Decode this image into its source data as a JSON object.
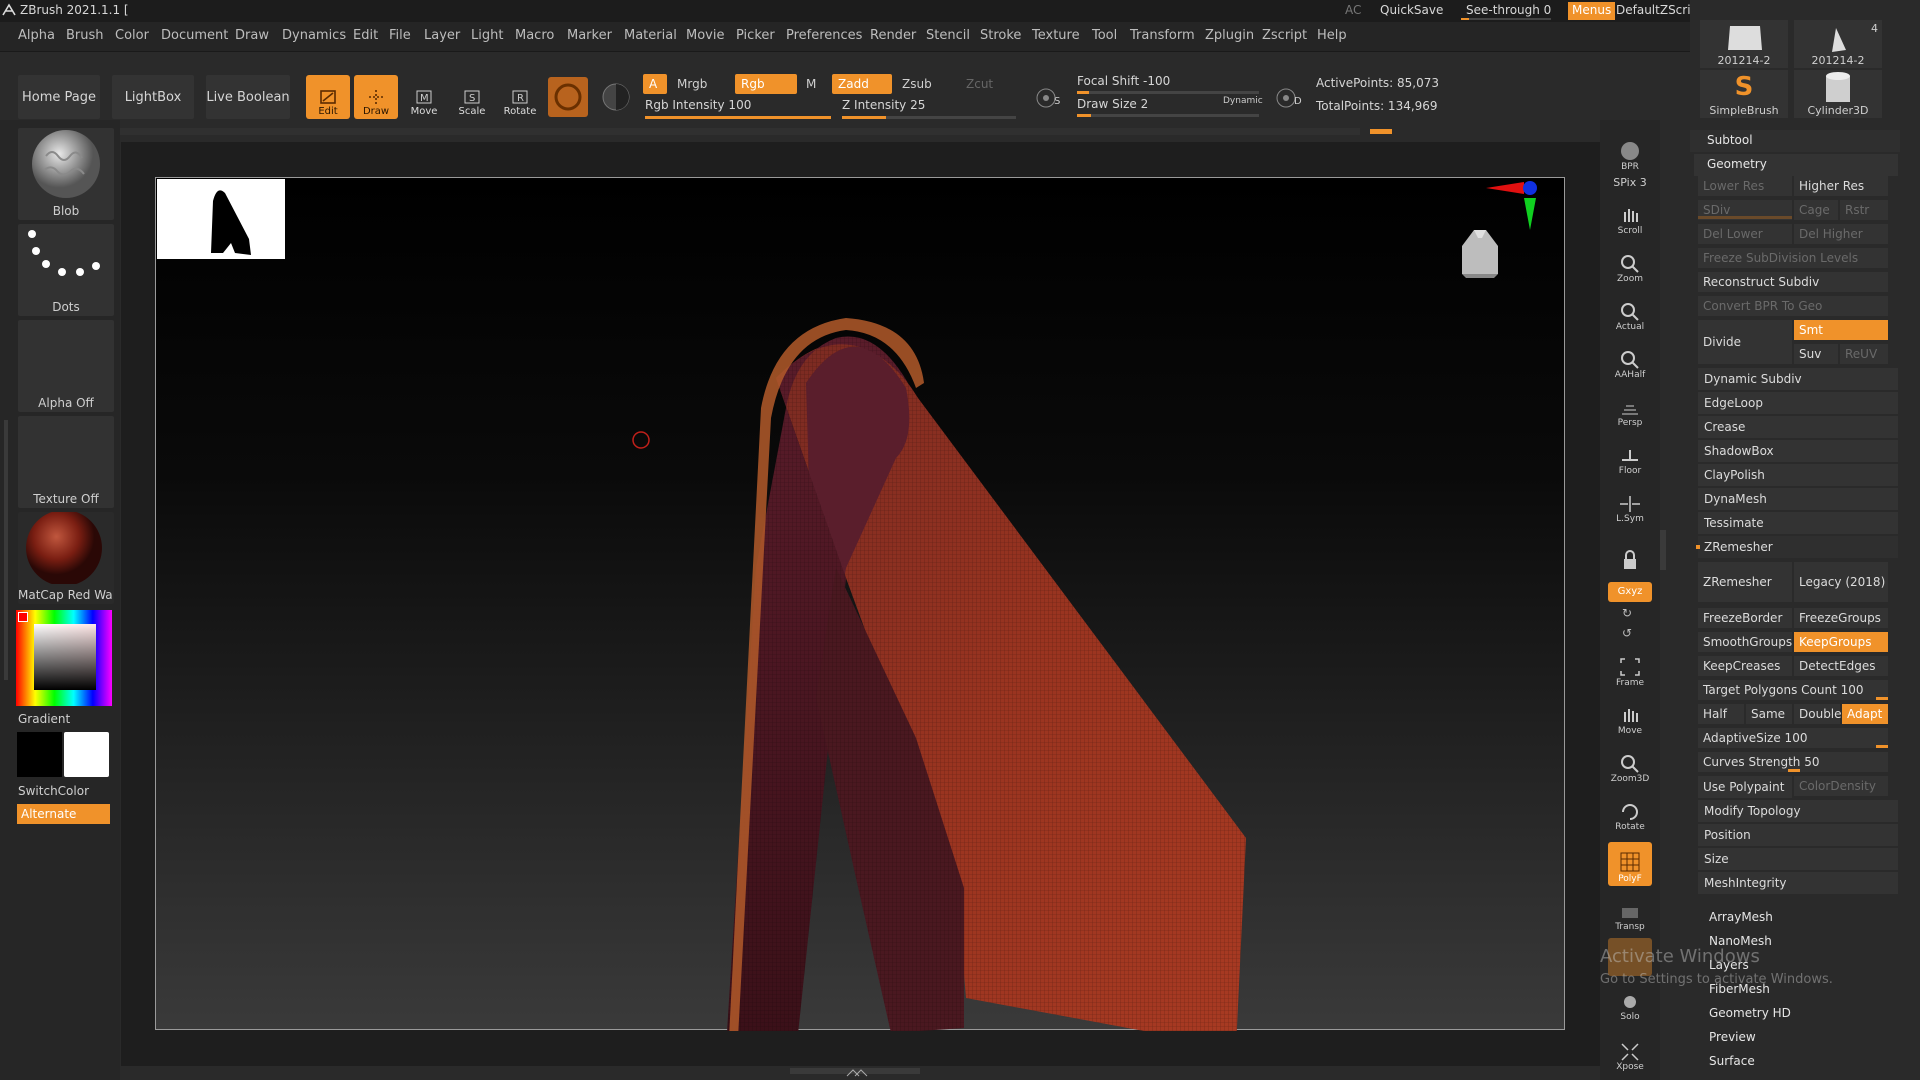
{
  "title": "ZBrush 2021.1.1 [",
  "titlebar": {
    "ac": "AC",
    "quicksave": "QuickSave",
    "seethrough": "See-through  0",
    "menus": "Menus",
    "script": "DefaultZScript"
  },
  "menu": [
    "Alpha",
    "Brush",
    "Color",
    "Document",
    "Draw",
    "Dynamics",
    "Edit",
    "File",
    "Layer",
    "Light",
    "Macro",
    "Marker",
    "Material",
    "Movie",
    "Picker",
    "Preferences",
    "Render",
    "Stencil",
    "Stroke",
    "Texture",
    "Tool",
    "Transform",
    "Zplugin",
    "Zscript",
    "Help"
  ],
  "toolbar": {
    "home_page": "Home Page",
    "lightbox": "LightBox",
    "live_boolean": "Live Boolean",
    "edit": "Edit",
    "draw": "Draw",
    "move": "Move",
    "scale": "Scale",
    "rotate": "Rotate",
    "a": "A",
    "mrgb": "Mrgb",
    "rgb": "Rgb",
    "m": "M",
    "zadd": "Zadd",
    "zsub": "Zsub",
    "zcut": "Zcut",
    "rgb_intensity": "Rgb Intensity 100",
    "rgb_intensity_value": 1.0,
    "z_intensity": "Z Intensity 25",
    "z_intensity_value": 0.25,
    "focal_shift": "Focal Shift -100",
    "draw_size": "Draw Size 2",
    "dynamic": "Dynamic",
    "s": "S",
    "d": "D",
    "active_points": "ActivePoints: 85,073",
    "total_points": "TotalPoints: 134,969"
  },
  "left_shelf": {
    "brush": "Blob",
    "stroke": "Dots",
    "alpha": "Alpha Off",
    "texture": "Texture Off",
    "material": "MatCap Red Wa:",
    "gradient": "Gradient",
    "switchcolor": "SwitchColor",
    "alternate": "Alternate"
  },
  "right_tools": [
    {
      "label": "BPR",
      "on": false
    },
    {
      "label": "SPix 3",
      "on": false
    },
    {
      "label": "Scroll",
      "on": false
    },
    {
      "label": "Zoom",
      "on": false
    },
    {
      "label": "Actual",
      "on": false
    },
    {
      "label": "AAHalf",
      "on": false
    },
    {
      "label": "Persp",
      "on": false
    },
    {
      "label": "Floor",
      "on": false
    },
    {
      "label": "L.Sym",
      "on": false
    },
    {
      "label": "Lock",
      "on": false
    },
    {
      "label": "Gxyz",
      "on": true
    },
    {
      "label": "Frame",
      "on": false
    },
    {
      "label": "Move",
      "on": false
    },
    {
      "label": "Zoom3D",
      "on": false
    },
    {
      "label": "Rotate",
      "on": false
    },
    {
      "label": "PolyF",
      "on": true
    },
    {
      "label": "Transp",
      "on": false
    },
    {
      "label": "Solo",
      "on": false
    },
    {
      "label": "Xpose",
      "on": false
    }
  ],
  "subtools": [
    {
      "label": "201214-2",
      "count": ""
    },
    {
      "label": "201214-2",
      "count": "4"
    },
    {
      "label": "SimpleBrush",
      "count": ""
    },
    {
      "label": "Cylinder3D",
      "count": ""
    }
  ],
  "panel": {
    "subtool": "Subtool",
    "geometry": "Geometry",
    "lower_res": "Lower Res",
    "higher_res": "Higher Res",
    "sdiv": "SDiv",
    "cage": "Cage",
    "rstr": "Rstr",
    "del_lower": "Del Lower",
    "del_higher": "Del Higher",
    "freeze_subdiv": "Freeze SubDivision Levels",
    "reconstruct_subdiv": "Reconstruct Subdiv",
    "convert_bpr": "Convert BPR To Geo",
    "divide": "Divide",
    "smt": "Smt",
    "suv": "Suv",
    "reuv": "ReUV",
    "dynamic_subdiv": "Dynamic Subdiv",
    "edgeloop": "EdgeLoop",
    "crease": "Crease",
    "shadowbox": "ShadowBox",
    "claypolish": "ClayPolish",
    "dynamesh": "DynaMesh",
    "tessimate": "Tessimate",
    "zremesher_head": "ZRemesher",
    "zremesher": "ZRemesher",
    "legacy": "Legacy (2018)",
    "freezeborder": "FreezeBorder",
    "freezegroups": "FreezeGroups",
    "smoothgroups": "SmoothGroups",
    "keepgroups": "KeepGroups",
    "keepcreases": "KeepCreases",
    "detectedges": "DetectEdges",
    "target_polys": "Target Polygons Count 100",
    "half": "Half",
    "same": "Same",
    "double": "Double",
    "adapt": "Adapt",
    "adaptive_size": "AdaptiveSize 100",
    "curves_strength": "Curves Strength 50",
    "use_polypaint": "Use Polypaint",
    "colordensity": "ColorDensity",
    "modify_topology": "Modify Topology",
    "position": "Position",
    "size": "Size",
    "meshintegrity": "MeshIntegrity",
    "arraymesh": "ArrayMesh",
    "nanomesh": "NanoMesh",
    "layers": "Layers",
    "fibermesh": "FiberMesh",
    "geometry_hd": "Geometry HD",
    "preview": "Preview",
    "surface": "Surface"
  },
  "watermark": {
    "line1": "Activate Windows",
    "line2": "Go to Settings to activate Windows."
  },
  "colors": {
    "accent": "#f0922a",
    "mesh_dark": "#4a1a22",
    "mesh_red": "#9a3420"
  }
}
